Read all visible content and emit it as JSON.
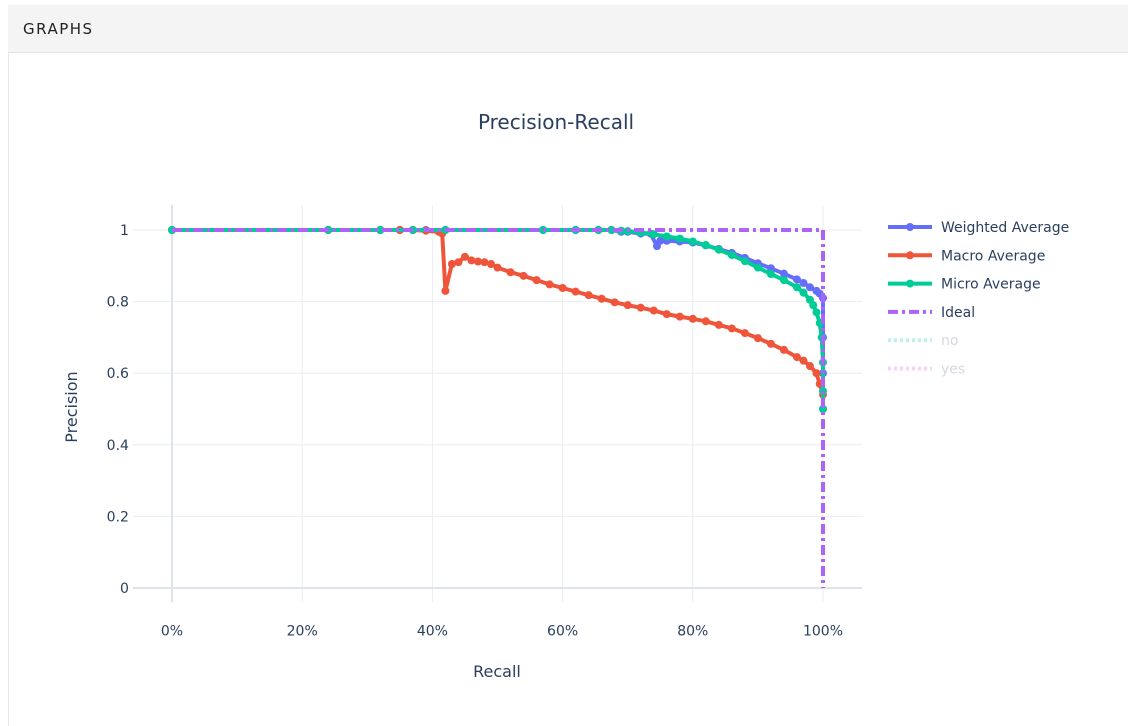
{
  "panel": {
    "title": "GRAPHS"
  },
  "colors": {
    "weighted": "#636efa",
    "macro": "#ef553b",
    "micro": "#00cc96",
    "ideal": "#ab63fa",
    "no": "#7fe5e5",
    "yes": "#f5a6f5",
    "grid": "#e9edf3",
    "text": "#2a3f5f",
    "legend_hidden_text": "#aab0bc"
  },
  "chart_data": {
    "type": "line",
    "title": "Precision-Recall",
    "xlabel": "Recall",
    "ylabel": "Precision",
    "xlim": [
      -0.06,
      1.06
    ],
    "ylim": [
      -0.04,
      1.07
    ],
    "x_ticks": [
      0,
      0.2,
      0.4,
      0.6,
      0.8,
      1.0
    ],
    "x_tick_labels": [
      "0%",
      "20%",
      "40%",
      "60%",
      "80%",
      "100%"
    ],
    "y_ticks": [
      0,
      0.2,
      0.4,
      0.6,
      0.8,
      1.0
    ],
    "y_tick_labels": [
      "0",
      "0.2",
      "0.4",
      "0.6",
      "0.8",
      "1"
    ],
    "grid": true,
    "legend_placement": "right",
    "series": [
      {
        "name": "Weighted Average",
        "color_key": "weighted",
        "mode": "lines+markers",
        "dash": "solid",
        "visible": true,
        "x": [
          0,
          0.24,
          0.32,
          0.35,
          0.37,
          0.39,
          0.42,
          0.57,
          0.62,
          0.655,
          0.675,
          0.69,
          0.7,
          0.72,
          0.735,
          0.745,
          0.75,
          0.76,
          0.78,
          0.8,
          0.82,
          0.84,
          0.86,
          0.88,
          0.9,
          0.92,
          0.94,
          0.96,
          0.97,
          0.98,
          0.99,
          0.995,
          1.0,
          1.0,
          1.0,
          1.0
        ],
        "y": [
          1,
          1,
          1,
          1,
          1,
          1,
          1,
          1,
          1,
          1,
          1,
          0.995,
          0.995,
          0.99,
          0.99,
          0.955,
          0.97,
          0.97,
          0.968,
          0.965,
          0.957,
          0.947,
          0.936,
          0.922,
          0.907,
          0.893,
          0.878,
          0.862,
          0.852,
          0.84,
          0.83,
          0.822,
          0.81,
          0.7,
          0.6,
          0.5
        ]
      },
      {
        "name": "Macro Average",
        "color_key": "macro",
        "mode": "lines+markers",
        "dash": "solid",
        "visible": true,
        "x": [
          0,
          0.24,
          0.32,
          0.35,
          0.37,
          0.39,
          0.41,
          0.415,
          0.42,
          0.43,
          0.44,
          0.45,
          0.46,
          0.47,
          0.48,
          0.49,
          0.5,
          0.52,
          0.54,
          0.56,
          0.58,
          0.6,
          0.62,
          0.64,
          0.66,
          0.68,
          0.7,
          0.72,
          0.74,
          0.76,
          0.78,
          0.8,
          0.82,
          0.84,
          0.86,
          0.88,
          0.9,
          0.92,
          0.94,
          0.96,
          0.97,
          0.98,
          0.99,
          0.995,
          1.0
        ],
        "y": [
          1,
          1,
          1,
          1,
          1,
          0.998,
          0.995,
          0.99,
          0.83,
          0.905,
          0.91,
          0.925,
          0.915,
          0.912,
          0.91,
          0.905,
          0.895,
          0.882,
          0.872,
          0.86,
          0.848,
          0.838,
          0.828,
          0.818,
          0.808,
          0.798,
          0.79,
          0.783,
          0.775,
          0.765,
          0.758,
          0.752,
          0.745,
          0.735,
          0.725,
          0.712,
          0.698,
          0.682,
          0.665,
          0.645,
          0.635,
          0.62,
          0.6,
          0.57,
          0.54
        ]
      },
      {
        "name": "Micro Average",
        "color_key": "micro",
        "mode": "lines+markers",
        "dash": "solid",
        "visible": true,
        "x": [
          0,
          0.24,
          0.32,
          0.37,
          0.42,
          0.57,
          0.62,
          0.655,
          0.675,
          0.69,
          0.7,
          0.72,
          0.74,
          0.76,
          0.78,
          0.8,
          0.82,
          0.84,
          0.86,
          0.88,
          0.9,
          0.92,
          0.94,
          0.96,
          0.97,
          0.98,
          0.985,
          0.99,
          0.995,
          0.998,
          1.0,
          1.0,
          1.0
        ],
        "y": [
          1,
          1,
          1,
          1,
          1,
          1,
          1,
          1,
          1,
          0.998,
          0.997,
          0.993,
          0.988,
          0.982,
          0.976,
          0.968,
          0.958,
          0.945,
          0.93,
          0.913,
          0.895,
          0.877,
          0.86,
          0.84,
          0.825,
          0.805,
          0.79,
          0.77,
          0.74,
          0.7,
          0.63,
          0.55,
          0.5
        ]
      },
      {
        "name": "Ideal",
        "color_key": "ideal",
        "mode": "lines",
        "dash": "dashdot",
        "visible": true,
        "x": [
          0,
          1,
          1
        ],
        "y": [
          1,
          1,
          0
        ]
      },
      {
        "name": "no",
        "color_key": "no",
        "mode": "lines",
        "dash": "dot",
        "visible": "legendonly",
        "x": [],
        "y": []
      },
      {
        "name": "yes",
        "color_key": "yes",
        "mode": "lines",
        "dash": "dot",
        "visible": "legendonly",
        "x": [],
        "y": []
      }
    ]
  }
}
